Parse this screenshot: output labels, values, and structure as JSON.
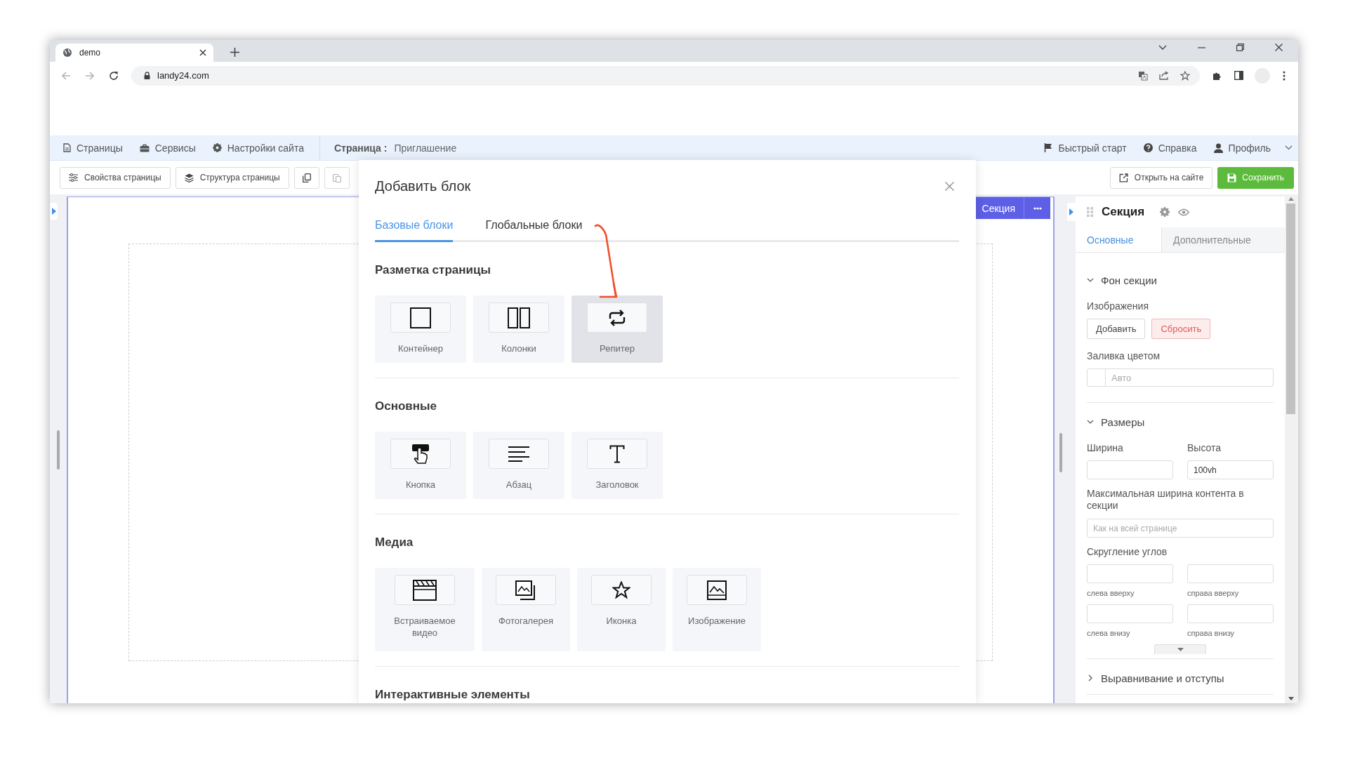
{
  "browser": {
    "tabs": [
      {
        "title": "demo",
        "selected": true
      }
    ],
    "address": "landy24.com"
  },
  "topbar": {
    "nav": [
      {
        "label": "Страницы"
      },
      {
        "label": "Сервисы"
      },
      {
        "label": "Настройки сайта"
      }
    ],
    "page_label": "Страница :",
    "page_name": "Приглашение",
    "right": [
      {
        "label": "Быстрый старт"
      },
      {
        "label": "Справка"
      },
      {
        "label": "Профиль"
      }
    ]
  },
  "toolbar": {
    "buttons": [
      {
        "label": "Свойства страницы"
      },
      {
        "label": "Структура страницы"
      }
    ],
    "icon_buttons": [
      {
        "disabled": false
      },
      {
        "disabled": true
      }
    ],
    "open_button": "Открыть на сайте",
    "save_button": "Сохранить"
  },
  "canvas": {
    "section_badge": "Секция"
  },
  "dialog": {
    "title": "Добавить блок",
    "tabs": [
      {
        "label": "Базовые блоки",
        "selected": true
      },
      {
        "label": "Глобальные блоки",
        "selected": false
      }
    ],
    "groups": [
      {
        "heading": "Разметка страницы",
        "blocks": [
          {
            "label": "Контейнер",
            "selected": false
          },
          {
            "label": "Колонки",
            "selected": false
          },
          {
            "label": "Репитер",
            "selected": true
          }
        ]
      },
      {
        "heading": "Основные",
        "blocks": [
          {
            "label": "Кнопка",
            "selected": false
          },
          {
            "label": "Абзац",
            "selected": false
          },
          {
            "label": "Заголовок",
            "selected": false
          }
        ]
      },
      {
        "heading": "Медиа",
        "blocks": [
          {
            "label": "Встраиваемое видео",
            "selected": false
          },
          {
            "label": "Фотогалерея",
            "selected": false
          },
          {
            "label": "Иконка",
            "selected": false
          },
          {
            "label": "Изображение",
            "selected": false
          }
        ]
      },
      {
        "heading": "Интерактивные элементы"
      }
    ]
  },
  "panel": {
    "title": "Секция",
    "tabs": [
      {
        "label": "Основные",
        "selected": true
      },
      {
        "label": "Дополнительные",
        "selected": false
      }
    ],
    "background": {
      "heading": "Фон секции",
      "expanded": true,
      "images_label": "Изображения",
      "add_button": "Добавить",
      "reset_button": "Сбросить",
      "fill_label": "Заливка цветом",
      "fill_placeholder": "Авто"
    },
    "sizes": {
      "heading": "Размеры",
      "expanded": true,
      "width_label": "Ширина",
      "height_label": "Высота",
      "height_value": "100vh",
      "max_width_label": "Максимальная ширина контента в секции",
      "max_width_placeholder": "Как на всей странице",
      "radius_label": "Скругление углов",
      "corners": [
        "слева вверху",
        "справа вверху",
        "слева внизу",
        "справа внизу"
      ]
    },
    "alignment": {
      "heading": "Выравнивание и отступы",
      "expanded": false
    }
  }
}
